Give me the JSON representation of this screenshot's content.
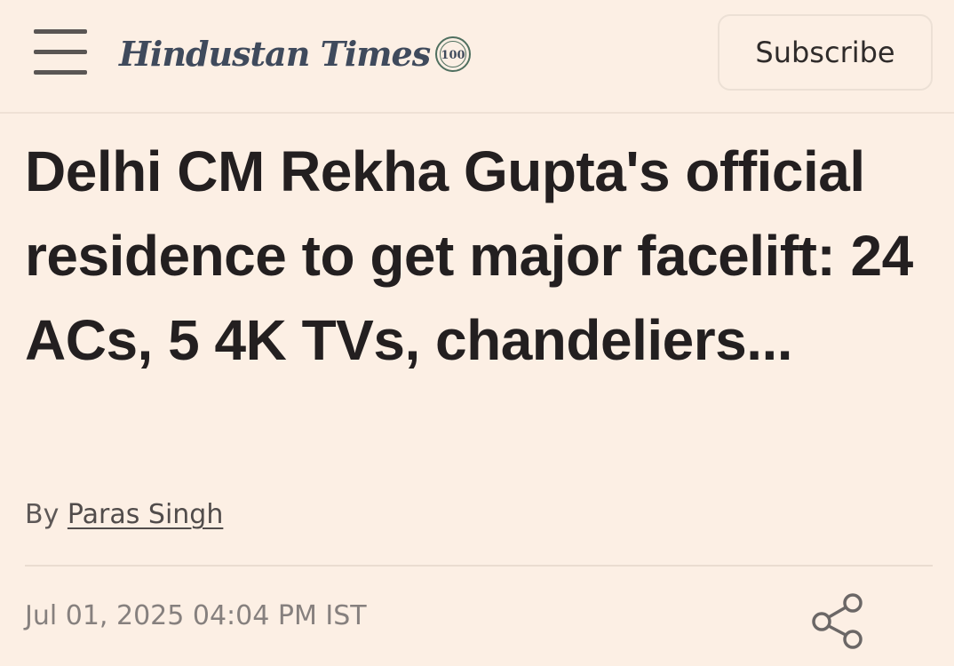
{
  "header": {
    "logo_text": "Hindustan Times",
    "logo_badge": "100",
    "subscribe_label": "Subscribe"
  },
  "article": {
    "headline": "Delhi CM Rekha Gupta's official residence to get major facelift: 24 ACs, 5 4K TVs, chandeliers...",
    "byline_prefix": "By",
    "author": "Paras Singh",
    "timestamp": "Jul 01, 2025 04:04 PM IST"
  },
  "icons": {
    "menu": "hamburger-menu-icon",
    "share": "share-icon"
  },
  "colors": {
    "background": "#fcefe4",
    "headline": "#231f20",
    "logo": "#3f4a5c"
  }
}
